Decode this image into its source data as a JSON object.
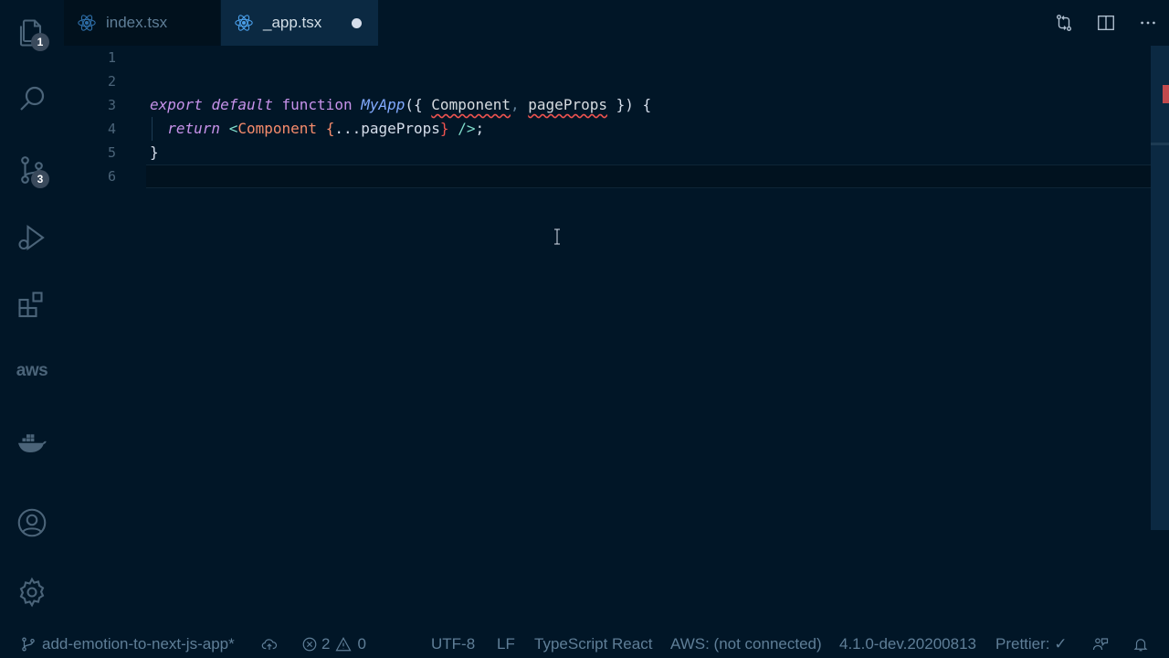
{
  "activity_bar": {
    "explorer_badge": "1",
    "source_control_badge": "3",
    "aws_label": "aws"
  },
  "tabs": [
    {
      "label": "index.tsx",
      "active": false
    },
    {
      "label": "_app.tsx",
      "active": true,
      "modified": true
    }
  ],
  "editor": {
    "line_numbers": [
      "1",
      "2",
      "3",
      "4",
      "5",
      "6"
    ],
    "code": {
      "l3_export": "export",
      "l3_default": "default",
      "l3_function": "function",
      "l3_name": "MyApp",
      "l3_open": "({ ",
      "l3_param1": "Component",
      "l3_comma": ",",
      "l3_param2": "pageProps",
      "l3_close": " }) {",
      "l4_return": "return",
      "l4_lt": "<",
      "l4_tag": "Component",
      "l4_brace_open": "{",
      "l4_spread": "...pageProps",
      "l4_brace_close": "}",
      "l4_end": " />",
      "l4_semi": ";",
      "l5": "}"
    }
  },
  "status_bar": {
    "branch": "add-emotion-to-next-js-app*",
    "errors": "2",
    "warnings": "0",
    "encoding": "UTF-8",
    "eol": "LF",
    "language": "TypeScript React",
    "aws": "AWS: (not connected)",
    "version": "4.1.0-dev.20200813",
    "prettier": "Prettier: ✓"
  },
  "colors": {
    "background": "#011627",
    "keyword": "#c792ea",
    "function": "#82aaff",
    "tag": "#f78c6c",
    "error": "#ef5350"
  }
}
